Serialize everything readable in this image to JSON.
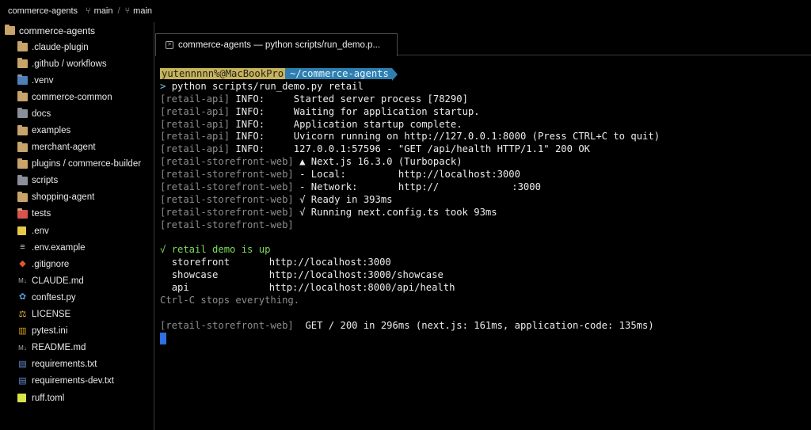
{
  "titlebar": {
    "project": "commerce-agents",
    "branch1": "main",
    "branch2": "main"
  },
  "sidebar": {
    "root": "commerce-agents",
    "items": [
      {
        "label": ".claude-plugin",
        "icon": "folder-icon"
      },
      {
        "label": ".github / workflows",
        "icon": "folder-icon"
      },
      {
        "label": ".venv",
        "icon": "python-folder-icon"
      },
      {
        "label": "commerce-common",
        "icon": "folder-icon"
      },
      {
        "label": "docs",
        "icon": "docs-folder-icon"
      },
      {
        "label": "examples",
        "icon": "folder-icon"
      },
      {
        "label": "merchant-agent",
        "icon": "folder-icon"
      },
      {
        "label": "plugins / commerce-builder",
        "icon": "folder-icon"
      },
      {
        "label": "scripts",
        "icon": "scripts-folder-icon"
      },
      {
        "label": "shopping-agent",
        "icon": "folder-icon"
      },
      {
        "label": "tests",
        "icon": "tests-folder-icon"
      },
      {
        "label": ".env",
        "icon": "env-file-icon"
      },
      {
        "label": ".env.example",
        "icon": "list-file-icon"
      },
      {
        "label": ".gitignore",
        "icon": "git-icon"
      },
      {
        "label": "CLAUDE.md",
        "icon": "markdown-icon"
      },
      {
        "label": "conftest.py",
        "icon": "python-icon"
      },
      {
        "label": "LICENSE",
        "icon": "license-icon"
      },
      {
        "label": "pytest.ini",
        "icon": "config-icon"
      },
      {
        "label": "README.md",
        "icon": "markdown-icon"
      },
      {
        "label": "requirements.txt",
        "icon": "requirements-icon"
      },
      {
        "label": "requirements-dev.txt",
        "icon": "requirements-icon"
      },
      {
        "label": "ruff.toml",
        "icon": "toml-icon"
      }
    ]
  },
  "tab": {
    "label": "commerce-agents — python scripts/run_demo.p..."
  },
  "terminal": {
    "prompt_user": "yutennnnn%@MacBookPro",
    "prompt_path": "~/commerce-agents",
    "command_prefix": ">",
    "command": "python scripts/run_demo.py retail",
    "api_lines": [
      {
        "tag": "[retail-api]",
        "level": "INFO:",
        "msg": "Started server process [78290]"
      },
      {
        "tag": "[retail-api]",
        "level": "INFO:",
        "msg": "Waiting for application startup."
      },
      {
        "tag": "[retail-api]",
        "level": "INFO:",
        "msg": "Application startup complete."
      },
      {
        "tag": "[retail-api]",
        "level": "INFO:",
        "msg": "Uvicorn running on http://127.0.0.1:8000 (Press CTRL+C to quit)"
      },
      {
        "tag": "[retail-api]",
        "level": "INFO:",
        "msg": "127.0.0.1:57596 - \"GET /api/health HTTP/1.1\" 200 OK"
      }
    ],
    "web_tag": "[retail-storefront-web]",
    "web_next": "▲ Next.js 16.3.0 (Turbopack)",
    "web_local_label": "- Local:",
    "web_local_url": "http://localhost:3000",
    "web_network_label": "- Network:",
    "web_network_prefix": "http://",
    "web_network_suffix": ":3000",
    "web_ready": "√ Ready in 393ms",
    "web_config": "√ Running next.config.ts took 93ms",
    "status": "√ retail demo is up",
    "links": [
      {
        "name": "storefront",
        "url": "http://localhost:3000"
      },
      {
        "name": "showcase",
        "url": "http://localhost:3000/showcase"
      },
      {
        "name": "api",
        "url": "http://localhost:8000/api/health"
      }
    ],
    "hint": "Ctrl-C stops everything.",
    "get_line": "GET / 200 in 296ms (next.js: 161ms, application-code: 135ms)"
  }
}
